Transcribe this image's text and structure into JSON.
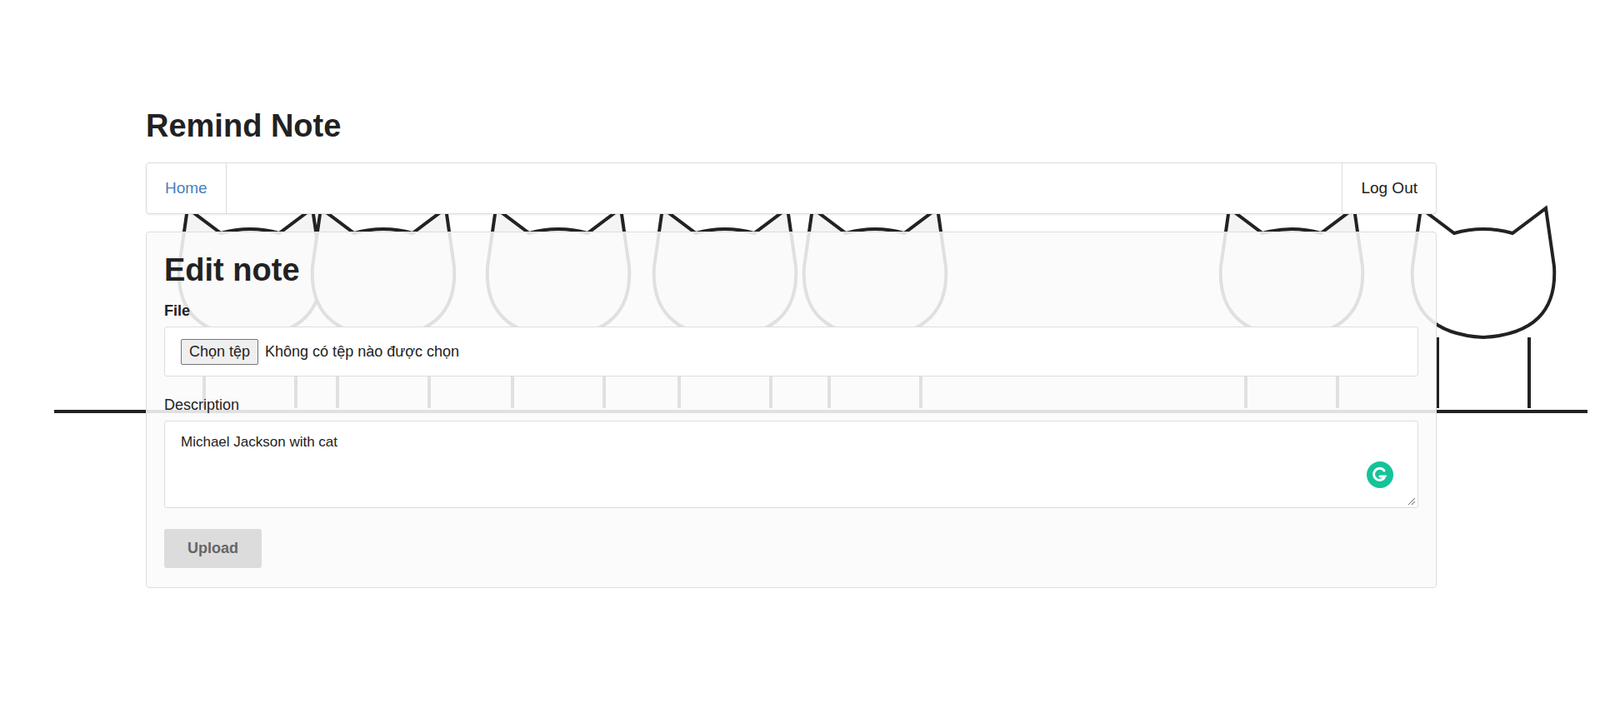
{
  "app_title": "Remind Note",
  "nav": {
    "left": [
      {
        "label": "Home"
      }
    ],
    "right": [
      {
        "label": "Log Out"
      }
    ]
  },
  "form": {
    "title": "Edit note",
    "file": {
      "label": "File",
      "button": "Chọn tệp",
      "status": "Không có tệp nào được chọn"
    },
    "description": {
      "label": "Description",
      "value": "Michael Jackson with cat"
    },
    "submit": {
      "label": "Upload",
      "disabled": true
    }
  }
}
